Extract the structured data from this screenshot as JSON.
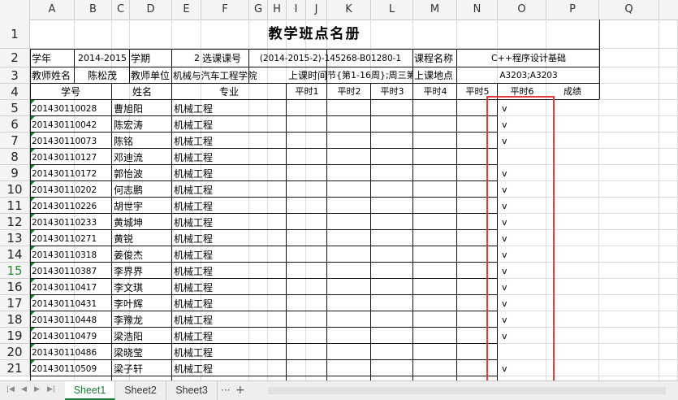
{
  "columns": [
    "A",
    "B",
    "C",
    "D",
    "E",
    "F",
    "G",
    "H",
    "I",
    "J",
    "K",
    "L",
    "M",
    "N",
    "O",
    "P",
    "Q"
  ],
  "rows": [
    "1",
    "2",
    "3",
    "4",
    "5",
    "6",
    "7",
    "8",
    "9",
    "10",
    "11",
    "12",
    "13",
    "14",
    "15",
    "16",
    "17",
    "18",
    "19",
    "20",
    "21"
  ],
  "selected_row": "15",
  "title": "教学班点名册",
  "meta": {
    "year_label": "学年",
    "year_value": "2014-2015",
    "term_label": "学期",
    "term_value": "2",
    "course_code_label": "选课课号",
    "course_code_value": "(2014-2015-2)-145268-B01280-1",
    "course_name_label": "课程名称",
    "course_name_value": "C++程序设计基础",
    "teacher_label": "教师姓名",
    "teacher_value": "陈松茂",
    "unit_label": "教师单位",
    "unit_value": "机械与汽车工程学院",
    "time_label": "上课时间",
    "time_value": "节{第1-16周};周三第7节",
    "place_label": "上课地点",
    "place_value": "A3203;A3203"
  },
  "headers": {
    "student_id": "学号",
    "name": "姓名",
    "major": "专业",
    "p1": "平时1",
    "p2": "平时2",
    "p3": "平时3",
    "p4": "平时4",
    "p5": "平时5",
    "p6": "平时6",
    "grade": "成绩"
  },
  "students": [
    {
      "id": "201430110028",
      "name": "曹旭阳",
      "major": "机械工程",
      "p6": "v"
    },
    {
      "id": "201430110042",
      "name": "陈宏涛",
      "major": "机械工程",
      "p6": "v"
    },
    {
      "id": "201430110073",
      "name": "陈铭",
      "major": "机械工程",
      "p6": "v"
    },
    {
      "id": "201430110127",
      "name": "邓迪流",
      "major": "机械工程",
      "p6": ""
    },
    {
      "id": "201430110172",
      "name": "郭怡波",
      "major": "机械工程",
      "p6": "v"
    },
    {
      "id": "201430110202",
      "name": "何志鹏",
      "major": "机械工程",
      "p6": "v"
    },
    {
      "id": "201430110226",
      "name": "胡世宇",
      "major": "机械工程",
      "p6": "v"
    },
    {
      "id": "201430110233",
      "name": "黄城坤",
      "major": "机械工程",
      "p6": "v"
    },
    {
      "id": "201430110271",
      "name": "黄锐",
      "major": "机械工程",
      "p6": "v"
    },
    {
      "id": "201430110318",
      "name": "姜俊杰",
      "major": "机械工程",
      "p6": "v"
    },
    {
      "id": "201430110387",
      "name": "李界界",
      "major": "机械工程",
      "p6": "v"
    },
    {
      "id": "201430110417",
      "name": "李文琪",
      "major": "机械工程",
      "p6": "v"
    },
    {
      "id": "201430110431",
      "name": "李叶辉",
      "major": "机械工程",
      "p6": "v"
    },
    {
      "id": "201430110448",
      "name": "李豫龙",
      "major": "机械工程",
      "p6": "v"
    },
    {
      "id": "201430110479",
      "name": "梁浩阳",
      "major": "机械工程",
      "p6": "v"
    },
    {
      "id": "201430110486",
      "name": "梁晓莹",
      "major": "机械工程",
      "p6": ""
    },
    {
      "id": "201430110509",
      "name": "梁子轩",
      "major": "机械工程",
      "p6": "v"
    }
  ],
  "sheet_tabs": [
    "Sheet1",
    "Sheet2",
    "Sheet3"
  ],
  "active_tab": "Sheet1",
  "tab_more": "···",
  "tab_add": "+",
  "nav_icons": [
    "first-sheet-icon",
    "prev-sheet-icon",
    "next-sheet-icon",
    "last-sheet-icon"
  ],
  "colors": {
    "highlight_box": "#e23b3b",
    "active_tab": "#1e7b34",
    "error_triangle": "#1e7b34"
  }
}
